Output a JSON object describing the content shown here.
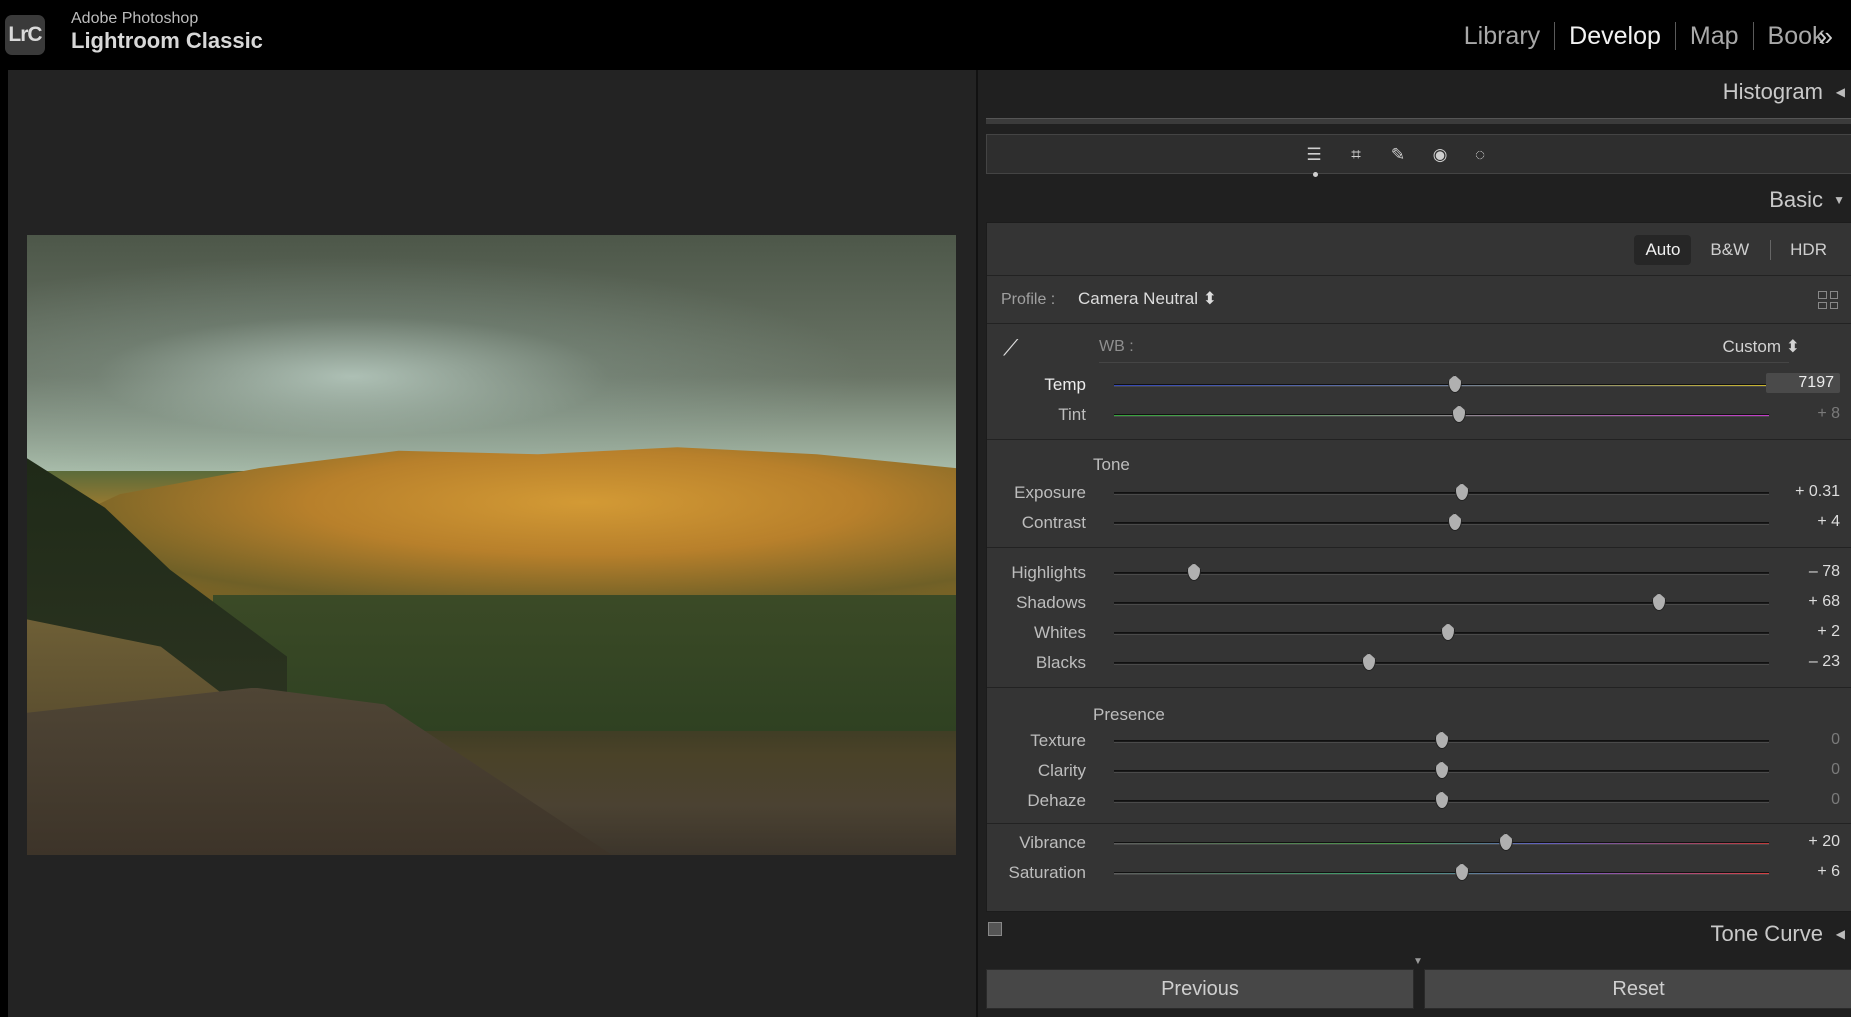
{
  "app": {
    "logo": "LrC",
    "brand_top": "Adobe Photoshop",
    "brand_main": "Lightroom Classic"
  },
  "modules": [
    {
      "label": "Library",
      "active": false
    },
    {
      "label": "Develop",
      "active": true
    },
    {
      "label": "Map",
      "active": false
    },
    {
      "label": "Book",
      "active": false
    }
  ],
  "module_more": "»",
  "panel": {
    "histogram_title": "Histogram",
    "basic_title": "Basic",
    "tone_curve_title": "Tone Curve",
    "treatment": {
      "auto": "Auto",
      "bw": "B&W",
      "hdr": "HDR"
    },
    "profile_label": "Profile :",
    "profile_value": "Camera Neutral ⬍",
    "wb_label": "WB :",
    "wb_value": "Custom ⬍",
    "tone_title": "Tone",
    "presence_title": "Presence",
    "sliders": {
      "temp": {
        "label": "Temp",
        "value": "7197",
        "position": 0.52
      },
      "tint": {
        "label": "Tint",
        "value": "+ 8",
        "position": 0.527
      },
      "exposure": {
        "label": "Exposure",
        "value": "+ 0.31",
        "position": 0.531
      },
      "contrast": {
        "label": "Contrast",
        "value": "+ 4",
        "position": 0.52
      },
      "highlights": {
        "label": "Highlights",
        "value": "– 78",
        "position": 0.122
      },
      "shadows": {
        "label": "Shadows",
        "value": "+ 68",
        "position": 0.832
      },
      "whites": {
        "label": "Whites",
        "value": "+ 2",
        "position": 0.51
      },
      "blacks": {
        "label": "Blacks",
        "value": "– 23",
        "position": 0.389
      },
      "texture": {
        "label": "Texture",
        "value": "0",
        "position": 0.5
      },
      "clarity": {
        "label": "Clarity",
        "value": "0",
        "position": 0.5
      },
      "dehaze": {
        "label": "Dehaze",
        "value": "0",
        "position": 0.5
      },
      "vibrance": {
        "label": "Vibrance",
        "value": "+ 20",
        "position": 0.598
      },
      "saturation": {
        "label": "Saturation",
        "value": "+ 6",
        "position": 0.531
      }
    },
    "buttons": {
      "previous": "Previous",
      "reset": "Reset"
    }
  },
  "icons": {
    "tools": [
      "sliders-icon",
      "crop-icon",
      "healing-icon",
      "redeye-icon",
      "masking-icon"
    ]
  }
}
